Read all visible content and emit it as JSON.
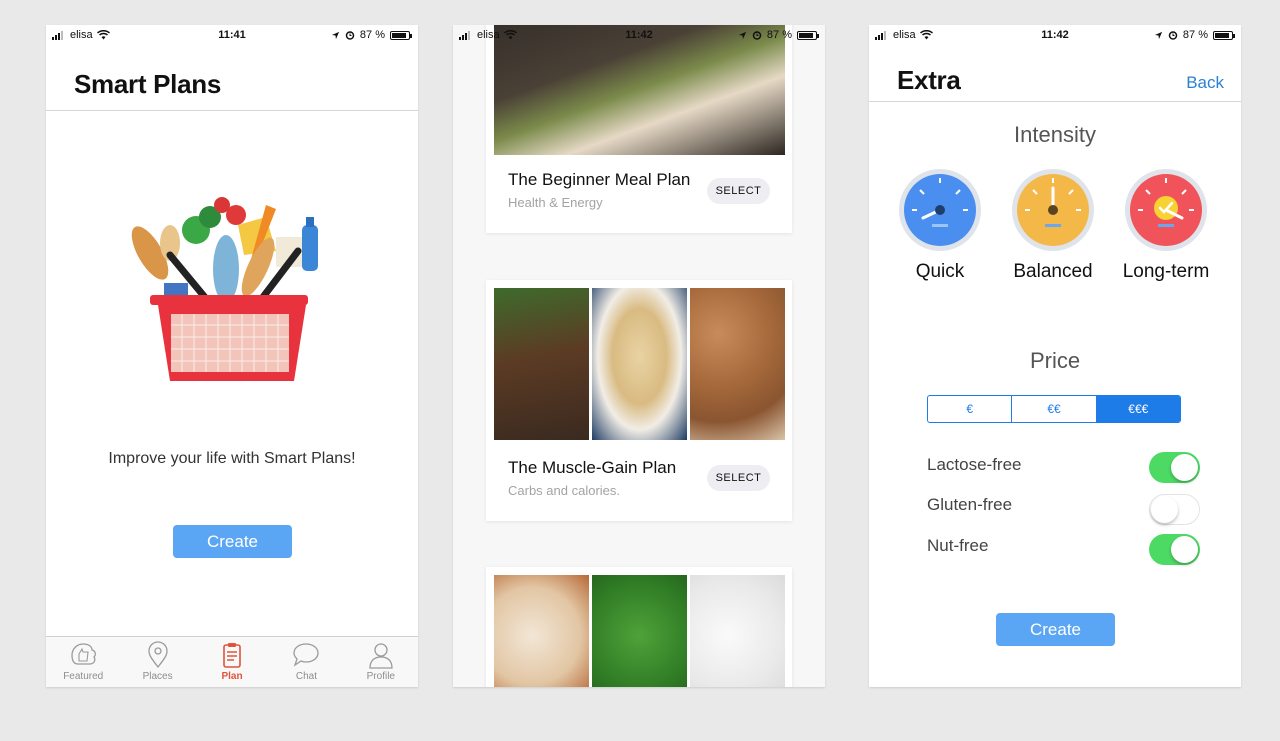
{
  "phone1": {
    "status": {
      "carrier": "elisa",
      "time": "11:41",
      "battery": "87 %"
    },
    "title": "Smart Plans",
    "tagline": "Improve your life with Smart Plans!",
    "create_label": "Create",
    "tabs": [
      {
        "label": "Featured",
        "icon": "thumbs-up-icon",
        "active": false
      },
      {
        "label": "Places",
        "icon": "map-pin-icon",
        "active": false
      },
      {
        "label": "Plan",
        "icon": "clipboard-icon",
        "active": true
      },
      {
        "label": "Chat",
        "icon": "chat-bubble-icon",
        "active": false
      },
      {
        "label": "Profile",
        "icon": "user-icon",
        "active": false
      }
    ]
  },
  "phone2": {
    "status": {
      "carrier": "elisa",
      "time": "11:42",
      "battery": "87 %"
    },
    "cards": [
      {
        "title": "The Beginner Meal Plan",
        "subtitle": "Health & Energy",
        "select_label": "SELECT"
      },
      {
        "title": "The Muscle-Gain Plan",
        "subtitle": "Carbs and calories.",
        "select_label": "SELECT"
      },
      {
        "title": "",
        "subtitle": "",
        "select_label": ""
      }
    ]
  },
  "phone3": {
    "status": {
      "carrier": "elisa",
      "time": "11:42",
      "battery": "87 %"
    },
    "title": "Extra",
    "back_label": "Back",
    "intensity_title": "Intensity",
    "intensity_options": [
      {
        "label": "Quick",
        "color": "#4a8ff0"
      },
      {
        "label": "Balanced",
        "color": "#f4b849"
      },
      {
        "label": "Long-term",
        "color": "#f0535a"
      }
    ],
    "price_title": "Price",
    "price_options": [
      "€",
      "€€",
      "€€€"
    ],
    "price_selected": "€€€",
    "diet_options": [
      {
        "label": "Lactose-free",
        "on": true
      },
      {
        "label": "Gluten-free",
        "on": false
      },
      {
        "label": "Nut-free",
        "on": true
      }
    ],
    "create_label": "Create"
  },
  "colors": {
    "accent": "#5aa6f4",
    "segment": "#1e7ce8",
    "toggle_on": "#4cd964",
    "tab_active": "#e0543b",
    "link": "#2a82d6"
  }
}
